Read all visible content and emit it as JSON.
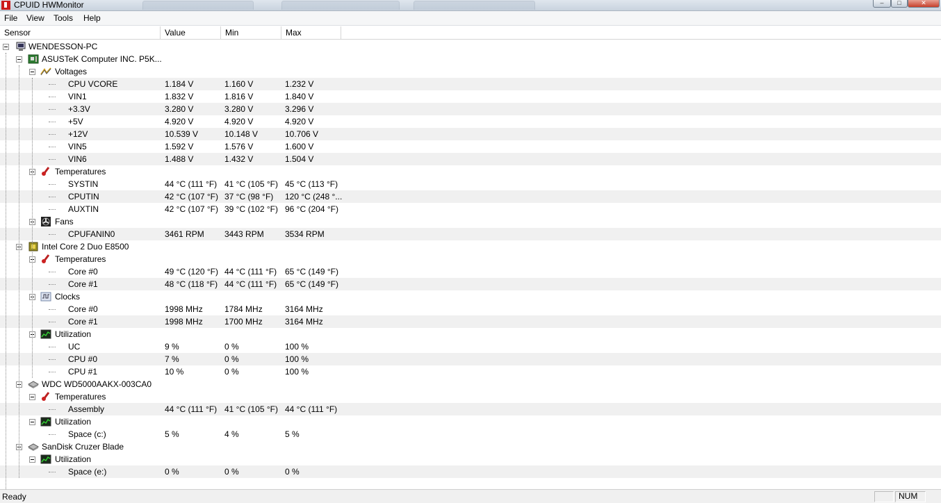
{
  "window": {
    "title": "CPUID HWMonitor"
  },
  "menu": [
    "File",
    "View",
    "Tools",
    "Help"
  ],
  "columns": {
    "sensor": "Sensor",
    "value": "Value",
    "min": "Min",
    "max": "Max"
  },
  "tree": [
    {
      "level": 0,
      "icon": "computer-icon",
      "label": "WENDESSON-PC"
    },
    {
      "level": 1,
      "icon": "motherboard-icon",
      "label": "ASUSTeK Computer INC. P5K..."
    },
    {
      "level": 2,
      "icon": "voltage-icon",
      "label": "Voltages"
    },
    {
      "level": 3,
      "label": "CPU VCORE",
      "value": "1.184 V",
      "min": "1.160 V",
      "max": "1.232 V"
    },
    {
      "level": 3,
      "label": "VIN1",
      "value": "1.832 V",
      "min": "1.816 V",
      "max": "1.840 V"
    },
    {
      "level": 3,
      "label": "+3.3V",
      "value": "3.280 V",
      "min": "3.280 V",
      "max": "3.296 V"
    },
    {
      "level": 3,
      "label": "+5V",
      "value": "4.920 V",
      "min": "4.920 V",
      "max": "4.920 V"
    },
    {
      "level": 3,
      "label": "+12V",
      "value": "10.539 V",
      "min": "10.148 V",
      "max": "10.706 V"
    },
    {
      "level": 3,
      "label": "VIN5",
      "value": "1.592 V",
      "min": "1.576 V",
      "max": "1.600 V"
    },
    {
      "level": 3,
      "label": "VIN6",
      "value": "1.488 V",
      "min": "1.432 V",
      "max": "1.504 V"
    },
    {
      "level": 2,
      "icon": "thermometer-icon",
      "label": "Temperatures"
    },
    {
      "level": 3,
      "label": "SYSTIN",
      "value": "44 °C  (111 °F)",
      "min": "41 °C  (105 °F)",
      "max": "45 °C  (113 °F)"
    },
    {
      "level": 3,
      "label": "CPUTIN",
      "value": "42 °C  (107 °F)",
      "min": "37 °C  (98 °F)",
      "max": "120 °C  (248 °..."
    },
    {
      "level": 3,
      "label": "AUXTIN",
      "value": "42 °C  (107 °F)",
      "min": "39 °C  (102 °F)",
      "max": "96 °C  (204 °F)"
    },
    {
      "level": 2,
      "icon": "fan-icon",
      "label": "Fans"
    },
    {
      "level": 3,
      "label": "CPUFANIN0",
      "value": "3461 RPM",
      "min": "3443 RPM",
      "max": "3534 RPM"
    },
    {
      "level": 1,
      "icon": "cpu-chip-icon",
      "label": "Intel Core 2 Duo E8500"
    },
    {
      "level": 2,
      "icon": "thermometer-icon",
      "label": "Temperatures"
    },
    {
      "level": 3,
      "label": "Core #0",
      "value": "49 °C  (120 °F)",
      "min": "44 °C  (111 °F)",
      "max": "65 °C  (149 °F)"
    },
    {
      "level": 3,
      "label": "Core #1",
      "value": "48 °C  (118 °F)",
      "min": "44 °C  (111 °F)",
      "max": "65 °C  (149 °F)"
    },
    {
      "level": 2,
      "icon": "clock-icon",
      "label": "Clocks"
    },
    {
      "level": 3,
      "label": "Core #0",
      "value": "1998 MHz",
      "min": "1784 MHz",
      "max": "3164 MHz"
    },
    {
      "level": 3,
      "label": "Core #1",
      "value": "1998 MHz",
      "min": "1700 MHz",
      "max": "3164 MHz"
    },
    {
      "level": 2,
      "icon": "utilization-icon",
      "label": "Utilization"
    },
    {
      "level": 3,
      "label": "UC",
      "value": "9 %",
      "min": "0 %",
      "max": "100 %"
    },
    {
      "level": 3,
      "label": "CPU #0",
      "value": "7 %",
      "min": "0 %",
      "max": "100 %"
    },
    {
      "level": 3,
      "label": "CPU #1",
      "value": "10 %",
      "min": "0 %",
      "max": "100 %"
    },
    {
      "level": 1,
      "icon": "hard-drive-icon",
      "label": "WDC WD5000AAKX-003CA0"
    },
    {
      "level": 2,
      "icon": "thermometer-icon",
      "label": "Temperatures"
    },
    {
      "level": 3,
      "label": "Assembly",
      "value": "44 °C  (111 °F)",
      "min": "41 °C  (105 °F)",
      "max": "44 °C  (111 °F)"
    },
    {
      "level": 2,
      "icon": "utilization-icon",
      "label": "Utilization"
    },
    {
      "level": 3,
      "label": "Space (c:)",
      "value": "5 %",
      "min": "4 %",
      "max": "5 %"
    },
    {
      "level": 1,
      "icon": "hard-drive-icon",
      "label": "SanDisk Cruzer Blade"
    },
    {
      "level": 2,
      "icon": "utilization-icon",
      "label": "Utilization"
    },
    {
      "level": 3,
      "label": "Space (e:)",
      "value": "0 %",
      "min": "0 %",
      "max": "0 %"
    }
  ],
  "status": {
    "text": "Ready",
    "num": "NUM"
  }
}
